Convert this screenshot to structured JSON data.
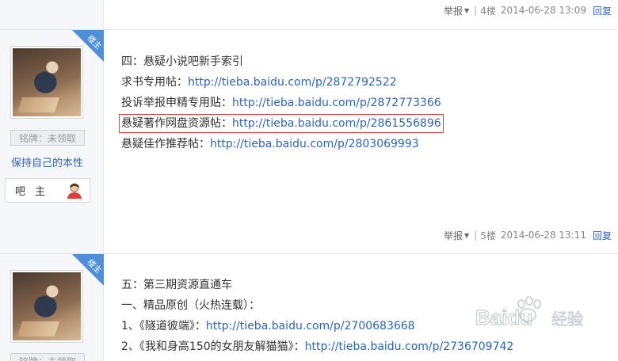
{
  "posts": [
    {
      "report_label": "举报",
      "floor": "4楼",
      "time": "2014-06-28 13:09",
      "reply_label": "回复"
    },
    {
      "badge": "楼主",
      "medal": "铭牌：未领取",
      "motto": "保持自己的本性",
      "role": "吧 主",
      "lines": [
        {
          "text": "四：悬疑小说吧新手索引",
          "link": ""
        },
        {
          "text": "求书专用帖：",
          "link": "http://tieba.baidu.com/p/2872792522"
        },
        {
          "text": "投诉举报申精专用贴：",
          "link": "http://tieba.baidu.com/p/2872773366"
        },
        {
          "text": "悬疑著作网盘资源帖：",
          "link": "http://tieba.baidu.com/p/2861556896"
        },
        {
          "text": "悬疑佳作推荐帖：",
          "link": "http://tieba.baidu.com/p/2803069993"
        }
      ],
      "report_label": "举报",
      "floor": "5楼",
      "time": "2014-06-28 13:11",
      "reply_label": "回复"
    },
    {
      "badge": "楼主",
      "medal": "铭牌：未领取",
      "lines": [
        {
          "text": "五：第三期资源直通车",
          "link": ""
        },
        {
          "text": "一、精品原创（火热连载）：",
          "link": ""
        },
        {
          "text": "1、《隧道彼端》：",
          "link": "http://tieba.baidu.com/p/2700683668"
        },
        {
          "text": "2、《我和身高150的女朋友解猫猫》：",
          "link": "http://tieba.baidu.com/p/2736709742"
        }
      ]
    }
  ],
  "watermark": {
    "brand": "Baidu",
    "label": "经验"
  },
  "colors": {
    "link": "#2d64b3",
    "highlight_border": "#e03c3c",
    "badge": "#4f8ed9"
  }
}
